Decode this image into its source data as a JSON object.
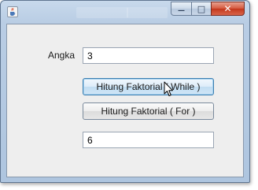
{
  "window": {
    "controls": {
      "minimize_glyph": "—",
      "maximize_glyph": "□",
      "close_glyph": "✕"
    },
    "icon": "java-cup-icon"
  },
  "form": {
    "angka_label": "Angka",
    "angka_value": "3",
    "button_while_label": "Hitung Faktorial ( While )",
    "button_for_label": "Hitung Faktorial ( For )",
    "result_value": "6"
  },
  "colors": {
    "close_button": "#c2361b",
    "focused_button_border": "#3c7fb1",
    "panel_background": "#eeeeee"
  }
}
